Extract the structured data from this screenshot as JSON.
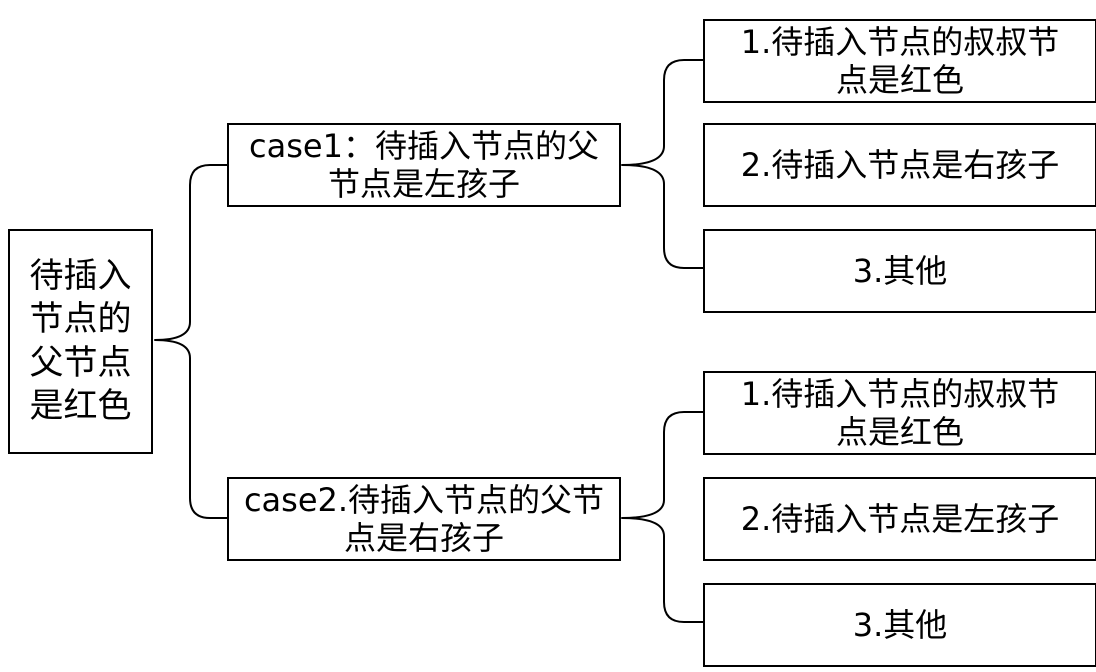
{
  "root": {
    "label": "待插入节点的父节点是红色"
  },
  "cases": [
    {
      "label": "case1：待插入节点的父节点是左孩子",
      "subcases": [
        "1.待插入节点的叔叔节点是红色",
        "2.待插入节点是右孩子",
        "3.其他"
      ]
    },
    {
      "label": "case2.待插入节点的父节点是右孩子",
      "subcases": [
        "1.待插入节点的叔叔节点是红色",
        "2.待插入节点是左孩子",
        "3.其他"
      ]
    }
  ],
  "colors": {
    "line": "#000000",
    "box_border": "#000000",
    "background": "#ffffff",
    "text": "#000000"
  }
}
